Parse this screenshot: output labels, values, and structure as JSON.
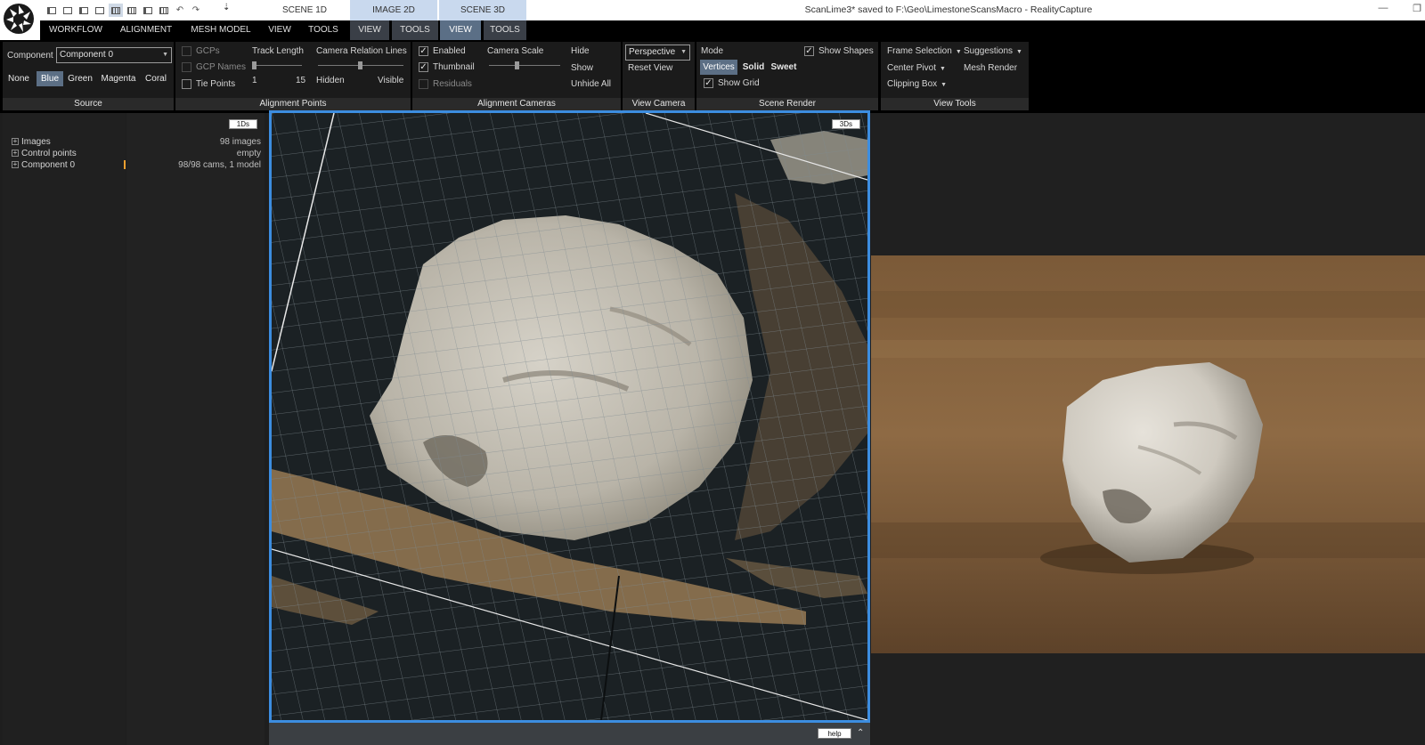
{
  "window": {
    "title": "ScanLime3* saved to F:\\Geo\\LimestoneScansMacro - RealityCapture",
    "minimize_glyph": "—",
    "restore_glyph": "❐",
    "more_glyph": "⇣"
  },
  "quick_access": {
    "icons": [
      "layout-1-icon",
      "layout-2-icon",
      "layout-3-icon",
      "layout-4-icon",
      "layout-5-icon",
      "layout-6-icon",
      "layout-7-icon",
      "layout-8-icon",
      "undo-icon",
      "redo-icon"
    ],
    "active_index": 4,
    "undo_glyph": "↶",
    "redo_glyph": "↷"
  },
  "scene_tabs": {
    "scene1d": "SCENE 1D",
    "image2d": "IMAGE 2D",
    "scene3d": "SCENE 3D"
  },
  "menu": {
    "workflow": "WORKFLOW",
    "alignment": "ALIGNMENT",
    "mesh_model": "MESH MODEL",
    "view": "VIEW",
    "tools": "TOOLS",
    "ctx_view_1": "VIEW",
    "ctx_tools_1": "TOOLS",
    "ctx_view_2": "VIEW",
    "ctx_tools_2": "TOOLS"
  },
  "ribbon": {
    "source": {
      "component_label": "Component",
      "component_value": "Component 0",
      "colors": [
        "None",
        "Blue",
        "Green",
        "Magenta",
        "Coral"
      ],
      "selected_color": "Blue",
      "panel_label": "Source"
    },
    "alignment_points": {
      "gcps": "GCPs",
      "gcp_names": "GCP Names",
      "tie_points": "Tie Points",
      "track_length": "Track Length",
      "track_min": "1",
      "track_max": "15",
      "camera_relation_lines": "Camera Relation Lines",
      "hidden": "Hidden",
      "visible": "Visible",
      "panel_label": "Alignment Points"
    },
    "alignment_cameras": {
      "enabled": "Enabled",
      "thumbnail": "Thumbnail",
      "residuals": "Residuals",
      "camera_scale": "Camera Scale",
      "hide": "Hide",
      "show": "Show",
      "unhide_all": "Unhide All",
      "panel_label": "Alignment Cameras"
    },
    "view_camera": {
      "projection": "Perspective",
      "reset_view": "Reset View",
      "panel_label": "View Camera"
    },
    "scene_render": {
      "mode_label": "Mode",
      "modes": [
        "Vertices",
        "Solid",
        "Sweet"
      ],
      "selected_mode": "Vertices",
      "show_shapes": "Show Shapes",
      "show_grid": "Show Grid",
      "panel_label": "Scene Render"
    },
    "view_tools": {
      "frame_selection": "Frame Selection",
      "suggestions": "Suggestions",
      "center_pivot": "Center Pivot",
      "mesh_render": "Mesh Render",
      "clipping_box": "Clipping Box",
      "panel_label": "View Tools"
    }
  },
  "tree": {
    "badge": "1Ds",
    "rows": [
      {
        "label": "Images",
        "value": "98 images"
      },
      {
        "label": "Control points",
        "value": "empty"
      },
      {
        "label": "Component 0",
        "value": "98/98 cams, 1 model"
      }
    ]
  },
  "viewport3d": {
    "badge": "3Ds",
    "help": "help"
  },
  "colors": {
    "accent_blue": "#3c8de0",
    "selected_button": "#5c6f85",
    "active_context_tab": "#5b6f86",
    "progress_marker": "#f0a030"
  }
}
